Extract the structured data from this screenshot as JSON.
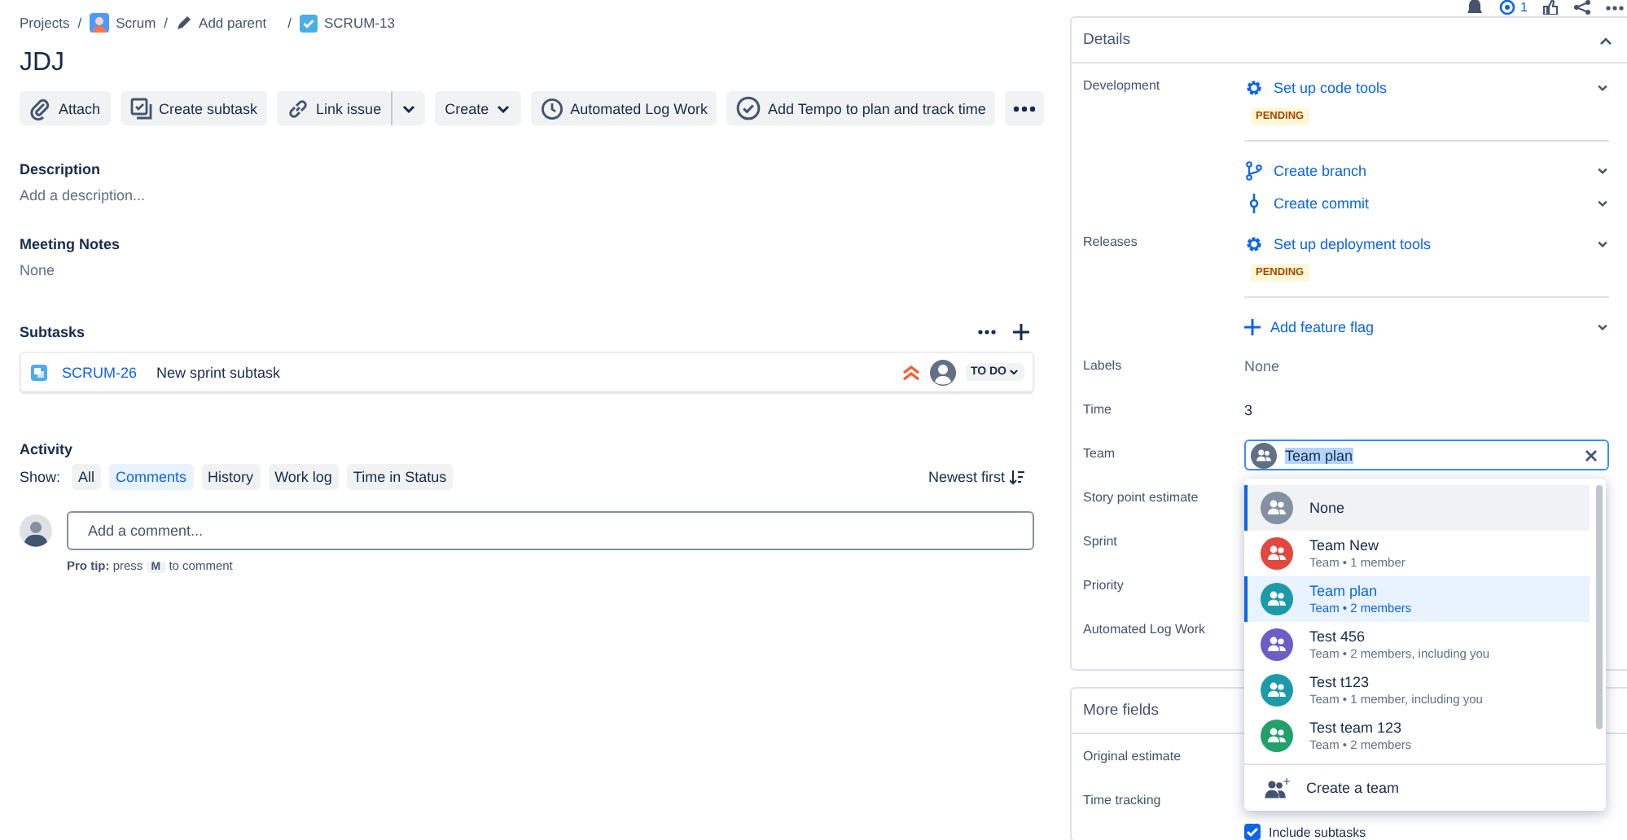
{
  "breadcrumb_separator": "/",
  "breadcrumbs": [
    {
      "kind": "text",
      "label": "Projects"
    },
    {
      "kind": "project",
      "label": "Scrum"
    },
    {
      "kind": "edit",
      "label": "Add parent"
    },
    {
      "kind": "issue",
      "label": "SCRUM-13"
    }
  ],
  "issue_title": "JDJ",
  "toolbar": [
    {
      "kind": "attach",
      "label": "Attach"
    },
    {
      "kind": "subtask",
      "label": "Create subtask"
    },
    {
      "kind": "link",
      "label": "Link issue",
      "split": true
    },
    {
      "kind": "create",
      "label": "Create"
    },
    {
      "kind": "clock",
      "label": "Automated Log Work"
    },
    {
      "kind": "check",
      "label": "Add Tempo to plan and track time"
    },
    {
      "kind": "more"
    }
  ],
  "description": {
    "heading": "Description",
    "placeholder": "Add a description..."
  },
  "meeting_notes": {
    "heading": "Meeting Notes",
    "value": "None"
  },
  "subtasks": {
    "heading": "Subtasks",
    "items": [
      {
        "key": "SCRUM-26",
        "summary": "New sprint subtask",
        "status": "TO DO"
      }
    ]
  },
  "activity": {
    "heading": "Activity",
    "show_label": "Show:",
    "filters": [
      {
        "label": "All",
        "selected": false
      },
      {
        "label": "Comments",
        "selected": true
      },
      {
        "label": "History",
        "selected": false
      },
      {
        "label": "Work log",
        "selected": false
      },
      {
        "label": "Time in Status",
        "selected": false
      }
    ],
    "sort": "Newest first",
    "comment_placeholder": "Add a comment...",
    "pro_tip": {
      "lead": "Pro tip:",
      "before": "press",
      "key": "M",
      "after": "to comment"
    }
  },
  "header_actions": {
    "watch_count": "1"
  },
  "details": {
    "title": "Details",
    "groups": [
      {
        "label": "Development",
        "items": [
          {
            "kind": "gear",
            "label": "Set up code tools",
            "badge": "PENDING"
          },
          {
            "kind": "branch",
            "label": "Create branch"
          },
          {
            "kind": "commit",
            "label": "Create commit"
          }
        ]
      },
      {
        "label": "Releases",
        "items": [
          {
            "kind": "gear",
            "label": "Set up deployment tools",
            "badge": "PENDING"
          },
          {
            "kind": "plus",
            "label": "Add feature flag"
          }
        ]
      }
    ],
    "fields": [
      {
        "kind": "text",
        "label": "Labels",
        "value": "None",
        "empty": true
      },
      {
        "kind": "text",
        "label": "Time",
        "value": "3",
        "empty": false
      },
      {
        "kind": "team",
        "label": "Team",
        "value": "Team plan"
      },
      {
        "kind": "hidden",
        "label": "Story point estimate"
      },
      {
        "kind": "hidden",
        "label": "Sprint"
      },
      {
        "kind": "hidden",
        "label": "Priority"
      },
      {
        "kind": "hidden",
        "label": "Automated Log Work"
      }
    ]
  },
  "more_fields": {
    "title": "More fields",
    "fields": [
      {
        "label": "Original estimate"
      },
      {
        "label": "Time tracking"
      }
    ],
    "include_subtasks": {
      "label": "Include subtasks",
      "checked": true
    }
  },
  "team_dropdown": {
    "options": [
      {
        "name": "None",
        "color": "#8590a2",
        "selected": false,
        "focused": true
      },
      {
        "name": "Team New",
        "meta": "Team • 1 member",
        "color": "#e2483d",
        "selected": false,
        "focused": false
      },
      {
        "name": "Team plan",
        "meta": "Team • 2 members",
        "color": "#1d9aaa",
        "selected": true,
        "focused": false
      },
      {
        "name": "Test 456",
        "meta": "Team • 2 members, including you",
        "color": "#6e5dc6",
        "selected": false,
        "focused": false
      },
      {
        "name": "Test t123",
        "meta": "Team • 1 member, including you",
        "color": "#1d9aaa",
        "selected": false,
        "focused": false
      },
      {
        "name": "Test team 123",
        "meta": "Team • 2 members",
        "color": "#22a06b",
        "selected": false,
        "focused": false
      }
    ],
    "footer": "Create a team"
  }
}
